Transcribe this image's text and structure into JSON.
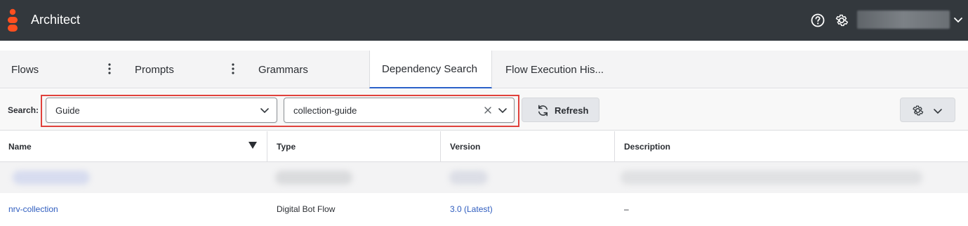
{
  "app": {
    "title": "Architect"
  },
  "header": {
    "icons": [
      "help-icon",
      "gear-icon",
      "chevron-down-icon"
    ]
  },
  "tabs": [
    {
      "label": "Flows"
    },
    {
      "label": "Prompts"
    },
    {
      "label": "Grammars"
    },
    {
      "label": "Dependency Search",
      "active": true
    },
    {
      "label": "Flow Execution His..."
    }
  ],
  "search": {
    "label": "Search:",
    "type_value": "Guide",
    "object_value": "collection-guide",
    "refresh_label": "Refresh"
  },
  "table": {
    "columns": [
      "Name",
      "Type",
      "Version",
      "Description"
    ],
    "sorted_column": "Name",
    "rows": [
      {
        "name": "nrv-collection",
        "type": "Digital Bot Flow",
        "version": "3.0 (Latest)",
        "description": "–"
      }
    ]
  },
  "colors": {
    "header_bg": "#33383d",
    "brand_orange": "#ff4f1f",
    "active_tab_underline": "#2a60c8",
    "highlight_border": "#e0413c",
    "link": "#2f5dbf"
  }
}
